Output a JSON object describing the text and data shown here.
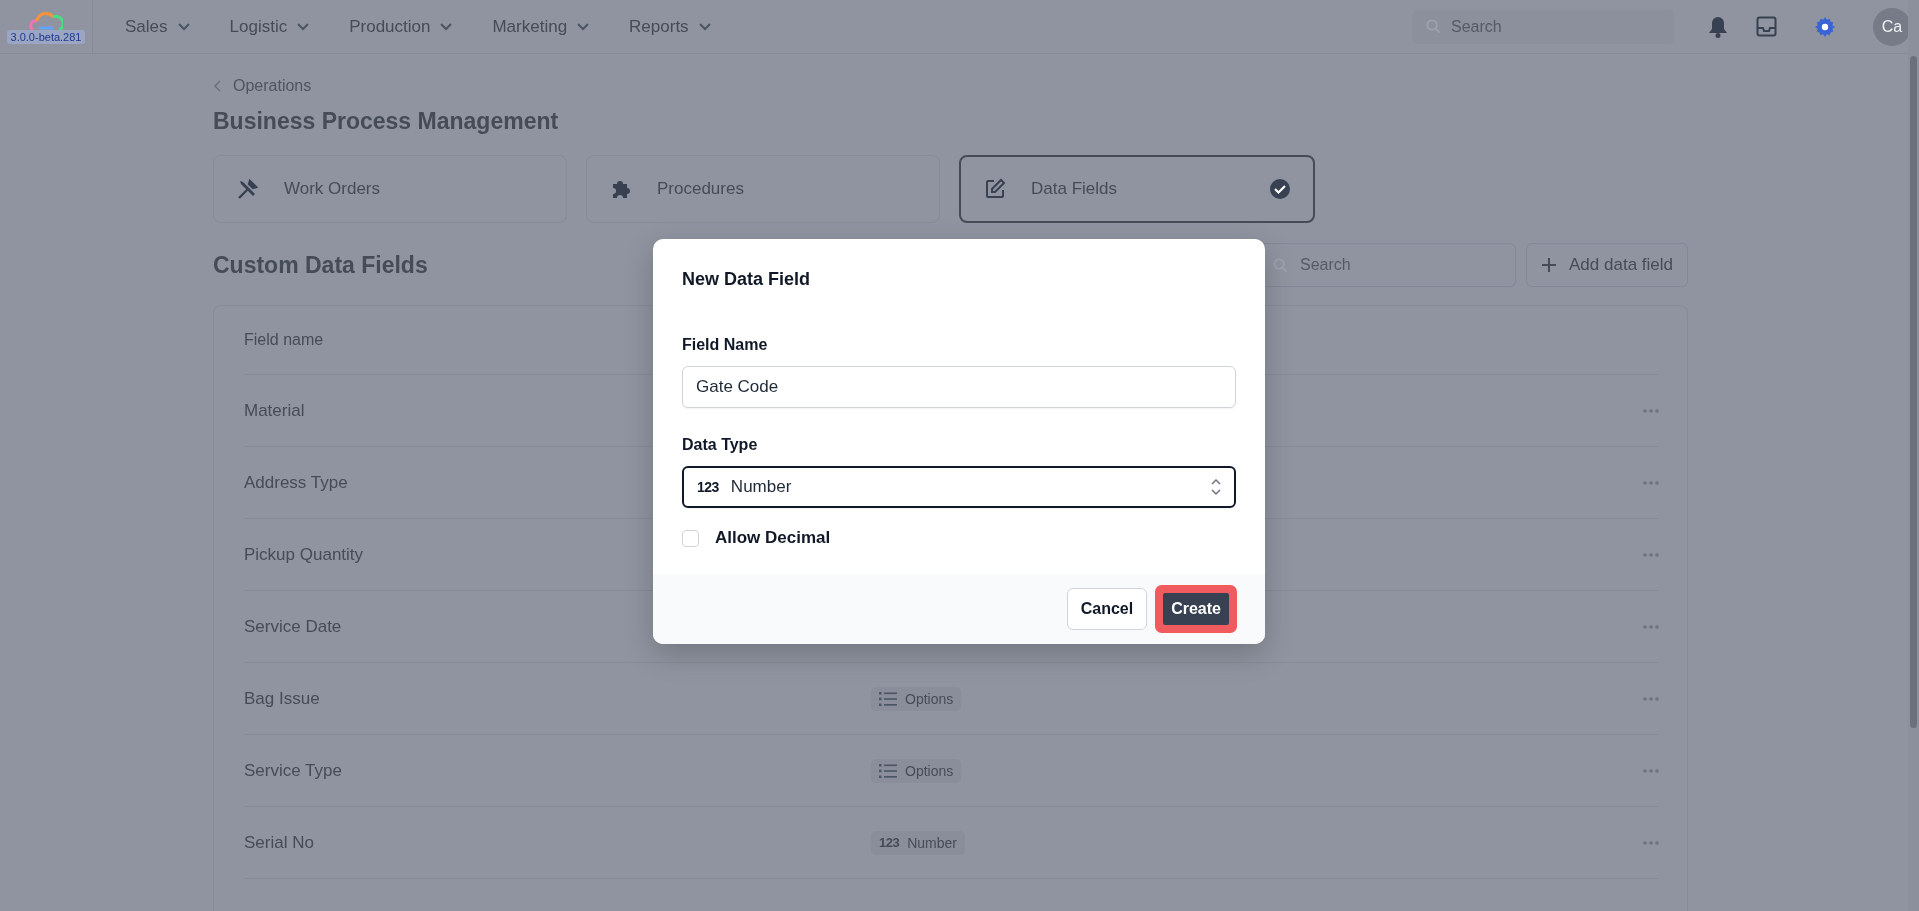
{
  "nav": {
    "version": "3.0.0-beta.281",
    "menus": [
      {
        "label": "Sales"
      },
      {
        "label": "Logistic"
      },
      {
        "label": "Production"
      },
      {
        "label": "Marketing"
      },
      {
        "label": "Reports"
      }
    ],
    "search": {
      "placeholder": "Search"
    },
    "avatar": "Ca"
  },
  "breadcrumb": "Operations",
  "title": "Business Process Management",
  "tabs": [
    {
      "label": "Work Orders",
      "selected": false
    },
    {
      "label": "Procedures",
      "selected": false
    },
    {
      "label": "Data Fields",
      "selected": true
    }
  ],
  "section": {
    "title": "Custom Data Fields",
    "search": {
      "placeholder": "Search"
    },
    "add_button": "Add data field"
  },
  "table": {
    "columns": [
      "Field name"
    ],
    "rows": [
      {
        "name": "Material"
      },
      {
        "name": "Address Type"
      },
      {
        "name": "Pickup Quantity"
      },
      {
        "name": "Service Date"
      },
      {
        "name": "Bag Issue",
        "type": {
          "kind": "options",
          "label": "Options"
        }
      },
      {
        "name": "Service Type",
        "type": {
          "kind": "options",
          "label": "Options"
        }
      },
      {
        "name": "Serial No",
        "type": {
          "kind": "number",
          "icon_text": "123",
          "label": "Number"
        }
      }
    ]
  },
  "dialog": {
    "title": "New Data Field",
    "field_name": {
      "label": "Field Name",
      "value": "Gate Code"
    },
    "data_type": {
      "label": "Data Type",
      "icon_text": "123",
      "value": "Number"
    },
    "allow_decimal": {
      "label": "Allow Decimal",
      "checked": false
    },
    "buttons": [
      {
        "label": "Cancel",
        "kind": "secondary",
        "highlighted": false
      },
      {
        "label": "Create",
        "kind": "primary",
        "highlighted": true
      }
    ]
  }
}
